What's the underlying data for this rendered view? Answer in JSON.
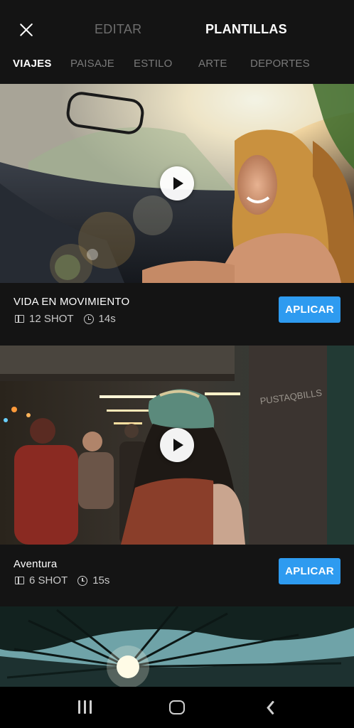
{
  "header": {
    "edit_label": "EDITAR",
    "templates_label": "PLANTILLAS"
  },
  "categories": [
    {
      "label": "VIAJES",
      "active": true
    },
    {
      "label": "PAISAJE",
      "active": false
    },
    {
      "label": "ESTILO",
      "active": false
    },
    {
      "label": "ARTE",
      "active": false
    },
    {
      "label": "DEPORTES",
      "active": false
    }
  ],
  "templates": [
    {
      "title": "VIDA EN MOVIMIENTO",
      "shots": "12 SHOT",
      "duration": "14s",
      "apply_label": "APLICAR"
    },
    {
      "title": "Aventura",
      "shots": "6 SHOT",
      "duration": "15s",
      "apply_label": "APLICAR"
    }
  ],
  "colors": {
    "accent": "#2e9bf0",
    "background": "#141414"
  },
  "icons": {
    "close": "close-icon",
    "play": "play-icon",
    "shot": "shot-icon",
    "clock": "clock-icon",
    "nav_recent": "recent-apps-icon",
    "nav_home": "home-icon",
    "nav_back": "back-icon"
  }
}
